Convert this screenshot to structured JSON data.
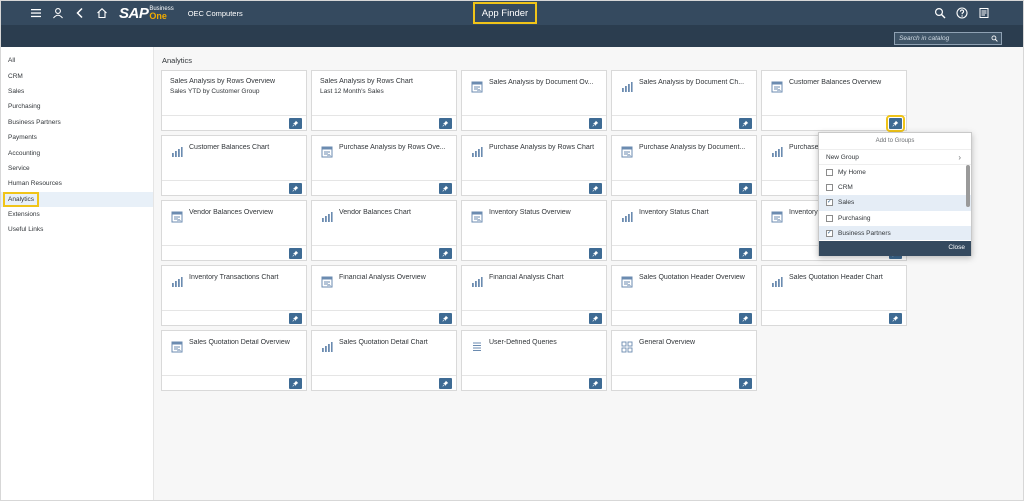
{
  "shell": {
    "company": "OEC Computers",
    "app_title": "App Finder",
    "logo_sap": "SAP",
    "logo_business": "Business",
    "logo_one": "One"
  },
  "search": {
    "placeholder": "Search in catalog"
  },
  "sidebar": {
    "items": [
      "All",
      "CRM",
      "Sales",
      "Purchasing",
      "Business Partners",
      "Payments",
      "Accounting",
      "Service",
      "Human Resources",
      "Analytics",
      "Extensions",
      "Useful Links"
    ],
    "selected": "Analytics"
  },
  "section": {
    "title": "Analytics"
  },
  "tiles": [
    {
      "title": "Sales Analysis by Rows Overview",
      "subtitle": "Sales YTD by Customer Group",
      "icon": "none"
    },
    {
      "title": "Sales Analysis by Rows Chart",
      "subtitle": "Last 12 Month's Sales",
      "icon": "none"
    },
    {
      "title": "Sales Analysis by Document Ov...",
      "subtitle": "",
      "icon": "overview-icon"
    },
    {
      "title": "Sales Analysis by Document Ch...",
      "subtitle": "",
      "icon": "chart-icon"
    },
    {
      "title": "Customer Balances Overview",
      "subtitle": "",
      "icon": "overview-icon"
    },
    {
      "title": "Customer Balances Chart",
      "subtitle": "",
      "icon": "chart-icon"
    },
    {
      "title": "Purchase Analysis by Rows Ove...",
      "subtitle": "",
      "icon": "overview-icon"
    },
    {
      "title": "Purchase Analysis by Rows Chart",
      "subtitle": "",
      "icon": "chart-icon"
    },
    {
      "title": "Purchase Analysis by Document...",
      "subtitle": "",
      "icon": "overview-icon"
    },
    {
      "title": "Purchase",
      "subtitle": "",
      "icon": "chart-icon"
    },
    {
      "title": "Vendor Balances Overview",
      "subtitle": "",
      "icon": "overview-icon"
    },
    {
      "title": "Vendor Balances Chart",
      "subtitle": "",
      "icon": "chart-icon"
    },
    {
      "title": "Inventory Status Overview",
      "subtitle": "",
      "icon": "overview-icon"
    },
    {
      "title": "Inventory Status Chart",
      "subtitle": "",
      "icon": "chart-icon"
    },
    {
      "title": "Inventory",
      "subtitle": "",
      "icon": "overview-icon"
    },
    {
      "title": "Inventory Transactions Chart",
      "subtitle": "",
      "icon": "chart-icon"
    },
    {
      "title": "Financial Analysis Overview",
      "subtitle": "",
      "icon": "overview-icon"
    },
    {
      "title": "Financial Analysis Chart",
      "subtitle": "",
      "icon": "chart-icon"
    },
    {
      "title": "Sales Quotation Header Overview",
      "subtitle": "",
      "icon": "overview-icon"
    },
    {
      "title": "Sales Quotation Header Chart",
      "subtitle": "",
      "icon": "chart-icon"
    },
    {
      "title": "Sales Quotation Detail Overview",
      "subtitle": "",
      "icon": "overview-icon"
    },
    {
      "title": "Sales Quotation Detail Chart",
      "subtitle": "",
      "icon": "chart-icon"
    },
    {
      "title": "User-Defined Queries",
      "subtitle": "",
      "icon": "list-icon"
    },
    {
      "title": "General Overview",
      "subtitle": "",
      "icon": "overview-grid-icon"
    }
  ],
  "popover": {
    "title": "Add to Groups",
    "new_group": "New Group",
    "groups": [
      {
        "label": "My Home",
        "checked": false,
        "selected": false
      },
      {
        "label": "CRM",
        "checked": false,
        "selected": false
      },
      {
        "label": "Sales",
        "checked": true,
        "selected": true
      },
      {
        "label": "Purchasing",
        "checked": false,
        "selected": false
      },
      {
        "label": "Business Partners",
        "checked": true,
        "selected": true
      }
    ],
    "close_label": "Close"
  },
  "colors": {
    "shell": "#354a5f",
    "subbar": "#2b3d4f",
    "highlight": "#f0c419",
    "pin": "#3e6b94"
  }
}
